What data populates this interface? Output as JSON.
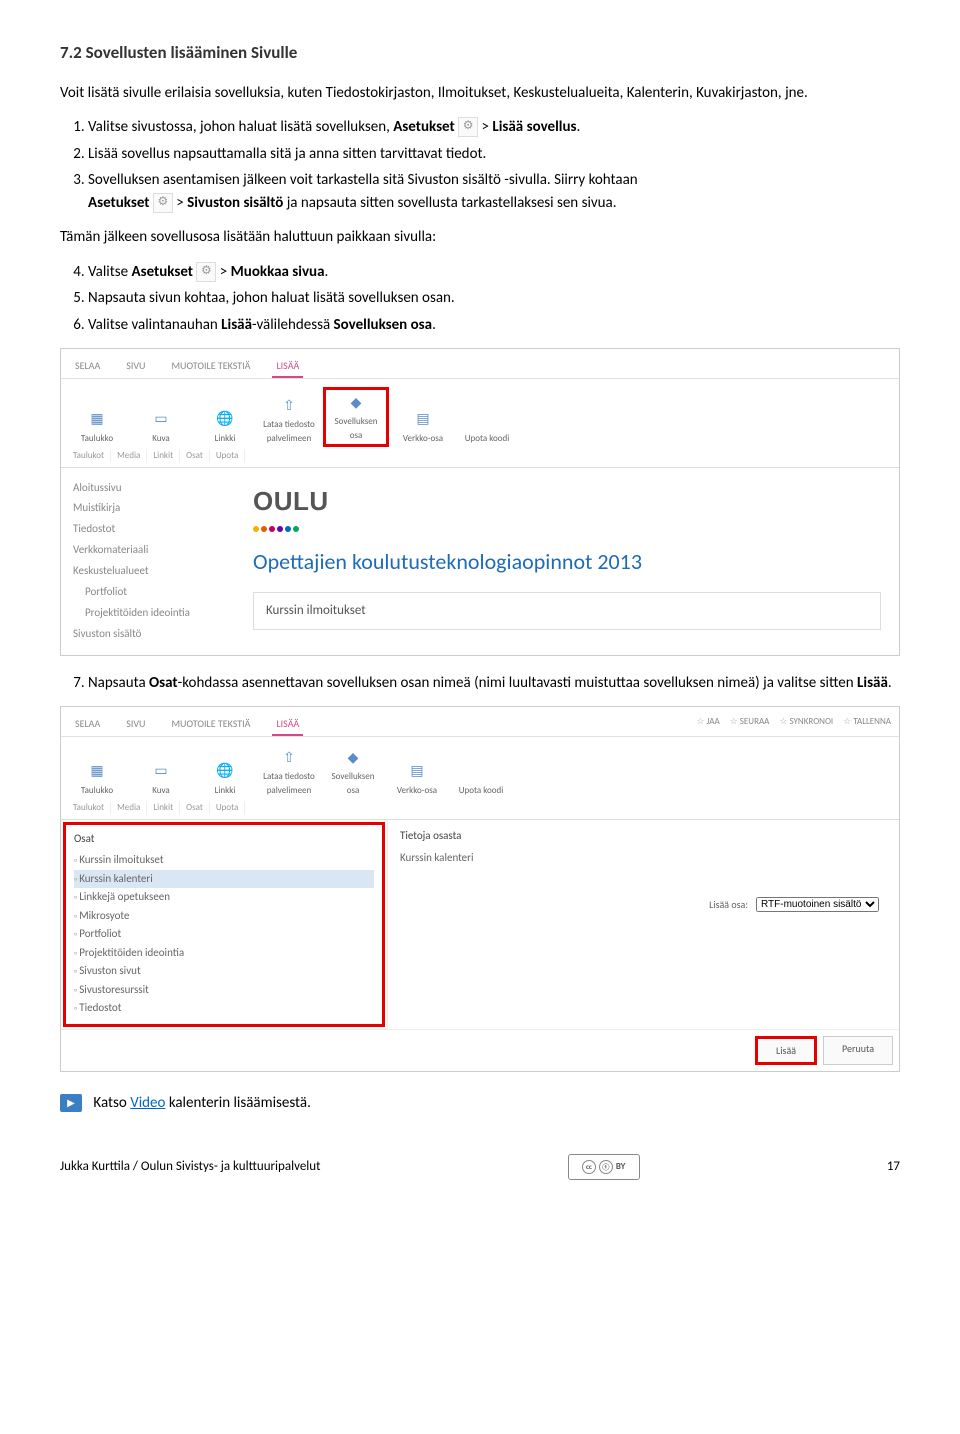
{
  "heading": "7.2  Sovellusten lisääminen Sivulle",
  "intro": "Voit lisätä sivulle erilaisia sovelluksia, kuten Tiedostokirjaston, Ilmoitukset, Keskustelualueita, Kalenterin, Kuvakirjaston, jne.",
  "step1_a": "Valitse sivustossa, johon haluat lisätä sovelluksen, ",
  "step1_b": "Asetukset",
  "step1_c": "  > ",
  "step1_d": "Lisää sovellus",
  "step1_e": ".",
  "step2": "Lisää sovellus napsauttamalla sitä ja anna sitten tarvittavat tiedot.",
  "step3_a": "Sovelluksen asentamisen jälkeen voit tarkastella sitä Sivuston sisältö -sivulla. Siirry kohtaan ",
  "step3_b": "Asetukset",
  "step3_c": "  > ",
  "step3_d": "Sivuston sisältö",
  "step3_e": " ja napsauta sitten sovellusta tarkastellaksesi sen sivua.",
  "mid": "Tämän jälkeen sovellusosa lisätään haluttuun paikkaan sivulla:",
  "step4_a": "Valitse ",
  "step4_b": "Asetukset",
  "step4_c": "  > ",
  "step4_d": "Muokkaa sivua",
  "step4_e": ".",
  "step5": "Napsauta sivun kohtaa, johon haluat lisätä sovelluksen osan.",
  "step6_a": "Valitse valintanauhan ",
  "step6_b": "Lisää",
  "step6_c": "-välilehdessä ",
  "step6_d": "Sovelluksen osa",
  "step6_e": ".",
  "step7_a": "Napsauta ",
  "step7_b": "Osat",
  "step7_c": "-kohdassa asennettavan sovelluksen osan nimeä (nimi luultavasti muistuttaa sovelluksen nimeä) ja valitse sitten ",
  "step7_d": "Lisää",
  "step7_e": ".",
  "fig1": {
    "tabs": [
      "SELAA",
      "SIVU",
      "MUOTOILE TEKSTIÄ",
      "LISÄÄ"
    ],
    "ribbon": [
      {
        "icon": "▦",
        "label": "Taulukko"
      },
      {
        "icon": "▭",
        "label": "Kuva"
      },
      {
        "icon": "🌐",
        "label": "Linkki"
      },
      {
        "icon": "⇧",
        "label": "Lataa tiedosto palvelimeen"
      },
      {
        "icon": "◆",
        "label": "Sovelluksen osa",
        "hl": true
      },
      {
        "icon": "▤",
        "label": "Verkko-osa"
      },
      {
        "icon": "</>",
        "label": "Upota koodi"
      }
    ],
    "groups": [
      "Taulukot",
      "Media",
      "Linkit",
      "Osat",
      "Upota"
    ],
    "nav": [
      "Aloitussivu",
      "Muistikirja",
      "Tiedostot",
      "Verkkomateriaali",
      "Keskustelualueet",
      "Portfoliot",
      "Projektitöiden ideointia",
      "Sivuston sisältö"
    ],
    "logo": "OULU",
    "title": "Opettajien koulutusteknologiaopinnot 2013",
    "card": "Kurssin ilmoitukset"
  },
  "fig2": {
    "right": [
      "JAA",
      "SEURAA",
      "SYNKRONOI",
      "TALLENNA"
    ],
    "osat_hdr": "Osat",
    "osat": [
      "Kurssin ilmoitukset",
      "Kurssin kalenteri",
      "Linkkejä opetukseen",
      "Mikrosyote",
      "Portfoliot",
      "Projektitöiden ideointia",
      "Sivuston sivut",
      "Sivustoresurssit",
      "Tiedostot"
    ],
    "info_hdr": "Tietoja osasta",
    "info_name": "Kurssin kalenteri",
    "add_label": "Lisää osa:",
    "add_opt": "RTF-muotoinen sisältö",
    "btn_add": "Lisää",
    "btn_cancel": "Peruuta"
  },
  "video_a": "Katso ",
  "video_link": "Video",
  "video_b": " kalenterin lisäämisestä.",
  "footer_author": "Jukka Kurttila / Oulun Sivistys- ja kulttuuripalvelut",
  "footer_page": "17"
}
